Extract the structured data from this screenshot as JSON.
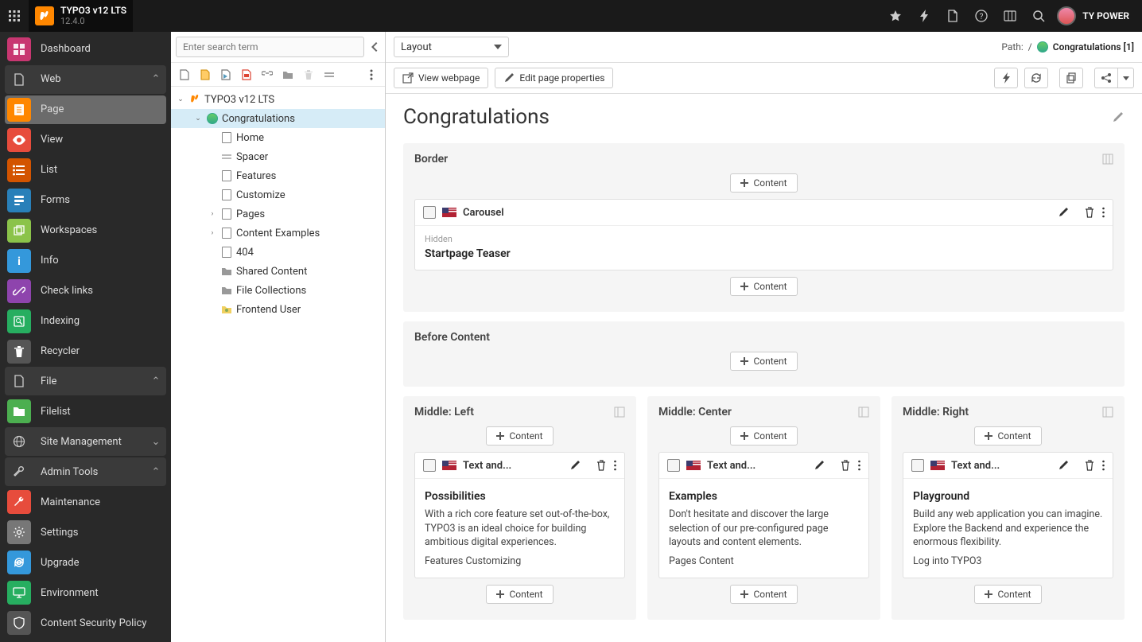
{
  "topbar": {
    "app_name": "TYPO3 v12 LTS",
    "version": "12.4.0",
    "username": "TY POWER"
  },
  "sidebar": {
    "dashboard": "Dashboard",
    "web": "Web",
    "page": "Page",
    "view": "View",
    "list": "List",
    "forms": "Forms",
    "workspaces": "Workspaces",
    "info": "Info",
    "check_links": "Check links",
    "indexing": "Indexing",
    "recycler": "Recycler",
    "file": "File",
    "filelist": "Filelist",
    "site_management": "Site Management",
    "admin_tools": "Admin Tools",
    "maintenance": "Maintenance",
    "settings": "Settings",
    "upgrade": "Upgrade",
    "environment": "Environment",
    "csp": "Content Security Policy"
  },
  "tree": {
    "search_placeholder": "Enter search term",
    "root": "TYPO3 v12 LTS",
    "nodes": {
      "congratulations": "Congratulations",
      "home": "Home",
      "spacer": "Spacer",
      "features": "Features",
      "customize": "Customize",
      "pages": "Pages",
      "content_examples": "Content Examples",
      "not_found": "404",
      "shared_content": "Shared Content",
      "file_collections": "File Collections",
      "frontend_user": "Frontend User"
    }
  },
  "content": {
    "layout_select": "Layout",
    "path_prefix": "Path:",
    "path_root": "/",
    "path_page": "Congratulations [1]",
    "view_webpage": "View webpage",
    "edit_page_properties": "Edit page properties",
    "page_title": "Congratulations",
    "add_content_label": "Content",
    "sections": {
      "border": "Border",
      "before_content": "Before Content",
      "middle_left": "Middle: Left",
      "middle_center": "Middle: Center",
      "middle_right": "Middle: Right"
    },
    "elements": {
      "carousel": {
        "type": "Carousel",
        "hidden_label": "Hidden",
        "title": "Startpage Teaser"
      },
      "left": {
        "type": "Text and...",
        "title": "Possibilities",
        "body": "With a rich core feature set out-of-the-box, TYPO3 is an ideal choice for building ambitious digital experiences.",
        "links": "Features Customizing"
      },
      "center": {
        "type": "Text and...",
        "title": "Examples",
        "body": "Don't hesitate and discover the large selection of our pre-configured page layouts and content elements.",
        "links": "Pages Content"
      },
      "right": {
        "type": "Text and...",
        "title": "Playground",
        "body": "Build any web application you can imagine. Explore the Backend and experience the enormous flexibility.",
        "links": "Log into TYPO3"
      }
    }
  }
}
